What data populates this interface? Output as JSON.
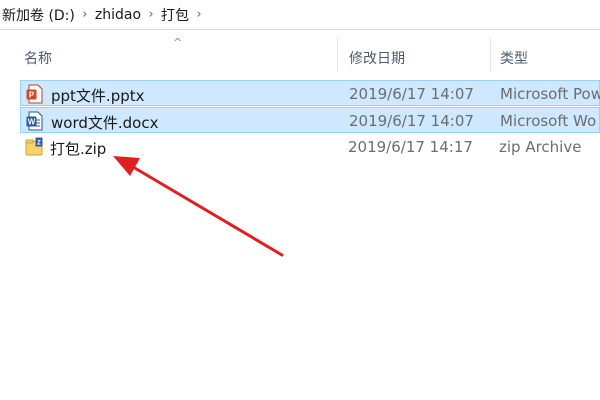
{
  "breadcrumb": {
    "items": [
      "新加卷 (D:)",
      "zhidao",
      "打包"
    ],
    "separator": "›"
  },
  "columns": {
    "name": "名称",
    "date": "修改日期",
    "type": "类型",
    "sort_indicator": "^"
  },
  "files": [
    {
      "name": "ppt文件.pptx",
      "date": "2019/6/17 14:07",
      "type": "Microsoft Pow",
      "icon": "powerpoint-file-icon",
      "selected": true
    },
    {
      "name": "word文件.docx",
      "date": "2019/6/17 14:07",
      "type": "Microsoft Wo",
      "icon": "word-file-icon",
      "selected": true
    },
    {
      "name": "打包.zip",
      "date": "2019/6/17 14:17",
      "type": "zip Archive",
      "icon": "zip-file-icon",
      "selected": false
    }
  ],
  "colors": {
    "selection_bg": "#cde8ff",
    "selection_border": "#99d1ff",
    "annotation_arrow": "#e02020"
  }
}
